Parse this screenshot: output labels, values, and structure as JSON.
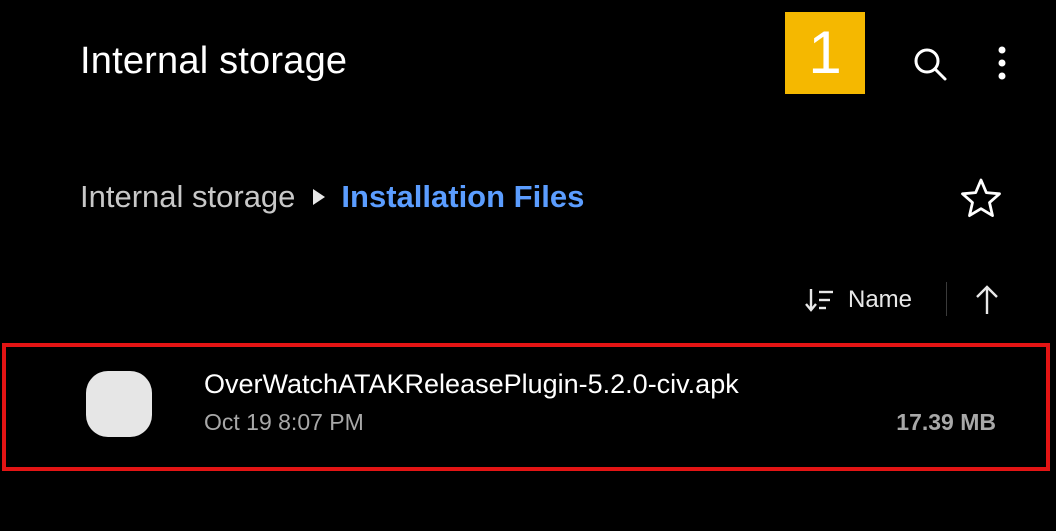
{
  "header": {
    "title": "Internal storage",
    "step_badge": "1",
    "search_icon": "search-icon",
    "more_icon": "more-vert-icon",
    "badge_color": "#f5b800"
  },
  "breadcrumb": {
    "root": "Internal storage",
    "separator_icon": "triangle-right-icon",
    "current": "Installation Files",
    "current_color": "#5b9dff",
    "favorite_icon": "star-outline-icon"
  },
  "sort": {
    "icon": "sort-icon",
    "label": "Name",
    "direction_icon": "arrow-up-icon"
  },
  "files": [
    {
      "name": "OverWatchATAKReleasePlugin-5.2.0-civ.apk",
      "modified": "Oct 19 8:07 PM",
      "size": "17.39 MB",
      "icon": "apk-file-icon",
      "highlight_color": "#e31414"
    }
  ]
}
